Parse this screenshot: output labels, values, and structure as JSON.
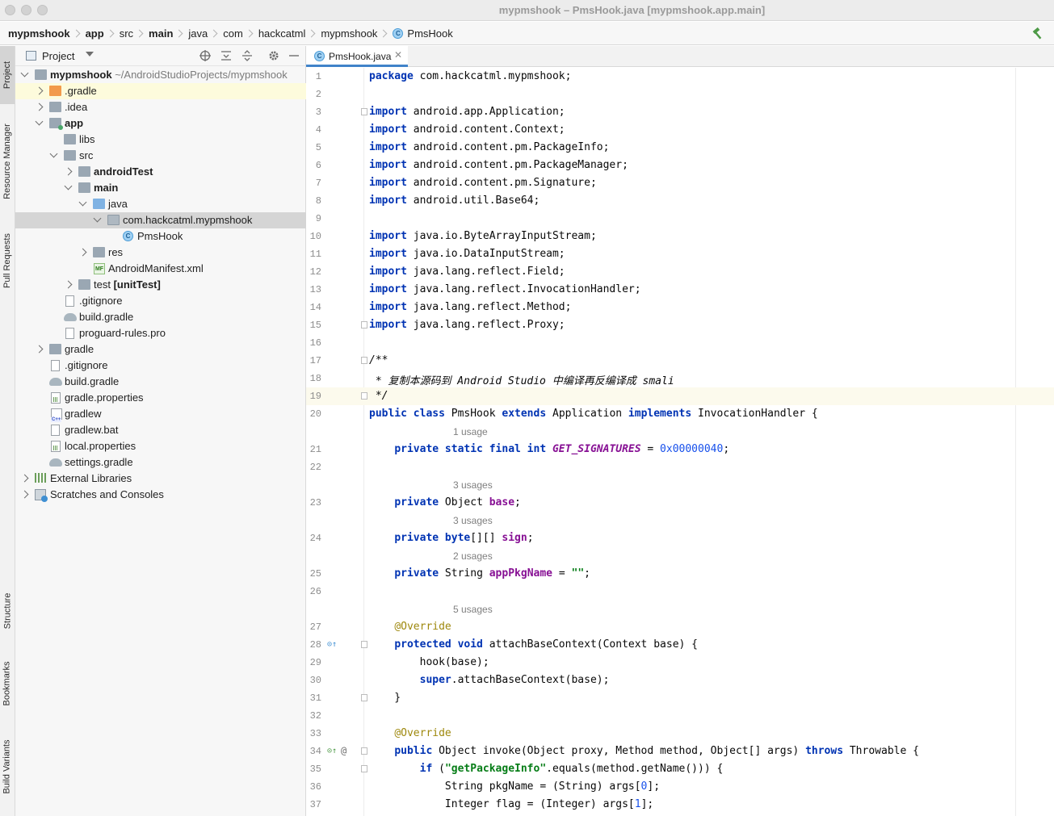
{
  "window": {
    "title": "mypmshook – PmsHook.java [mypmshook.app.main]"
  },
  "breadcrumbs": [
    "mypmshook",
    "app",
    "src",
    "main",
    "java",
    "com",
    "hackcatml",
    "mypmshook",
    "PmsHook"
  ],
  "tool_strip": {
    "top": [
      "Project",
      "Resource Manager",
      "Pull Requests"
    ],
    "bottom": [
      "Structure",
      "Bookmarks",
      "Build Variants"
    ]
  },
  "project_panel": {
    "title": "Project",
    "tree": [
      {
        "label": "mypmshook",
        "suffix": "~/AndroidStudioProjects/mypmshook"
      },
      {
        "label": ".gradle"
      },
      {
        "label": ".idea"
      },
      {
        "label": "app"
      },
      {
        "label": "libs"
      },
      {
        "label": "src"
      },
      {
        "label": "androidTest"
      },
      {
        "label": "main"
      },
      {
        "label": "java"
      },
      {
        "label": "com.hackcatml.mypmshook"
      },
      {
        "label": "PmsHook"
      },
      {
        "label": "res"
      },
      {
        "label": "AndroidManifest.xml"
      },
      {
        "label": "test",
        "suffix": "[unitTest]"
      },
      {
        "label": ".gitignore"
      },
      {
        "label": "build.gradle"
      },
      {
        "label": "proguard-rules.pro"
      },
      {
        "label": "gradle"
      },
      {
        "label": ".gitignore"
      },
      {
        "label": "build.gradle"
      },
      {
        "label": "gradle.properties"
      },
      {
        "label": "gradlew"
      },
      {
        "label": "gradlew.bat"
      },
      {
        "label": "local.properties"
      },
      {
        "label": "settings.gradle"
      },
      {
        "label": "External Libraries"
      },
      {
        "label": "Scratches and Consoles"
      }
    ]
  },
  "editor": {
    "tab_label": "PmsHook.java",
    "hints": {
      "h1": "1 usage",
      "h2": "3 usages",
      "h3": "3 usages",
      "h4": "2 usages",
      "h5": "5 usages"
    },
    "lines": [
      "package com.hackcatml.mypmshook;",
      "",
      "import android.app.Application;",
      "import android.content.Context;",
      "import android.content.pm.PackageInfo;",
      "import android.content.pm.PackageManager;",
      "import android.content.pm.Signature;",
      "import android.util.Base64;",
      "",
      "import java.io.ByteArrayInputStream;",
      "import java.io.DataInputStream;",
      "import java.lang.reflect.Field;",
      "import java.lang.reflect.InvocationHandler;",
      "import java.lang.reflect.Method;",
      "import java.lang.reflect.Proxy;",
      "",
      "/**",
      " * 复制本源码到 Android Studio 中编译再反编译成 smali",
      " */",
      "public class PmsHook extends Application implements InvocationHandler {",
      "    private static final int GET_SIGNATURES = 0x00000040;",
      "",
      "    private Object base;",
      "    private byte[][] sign;",
      "    private String appPkgName = \"\";",
      "",
      "    @Override",
      "    protected void attachBaseContext(Context base) {",
      "        hook(base);",
      "        super.attachBaseContext(base);",
      "    }",
      "",
      "    @Override",
      "    public Object invoke(Object proxy, Method method, Object[] args) throws Throwable {",
      "        if (\"getPackageInfo\".equals(method.getName())) {",
      "            String pkgName = (String) args[0];",
      "            Integer flag = (Integer) args[1];"
    ]
  }
}
